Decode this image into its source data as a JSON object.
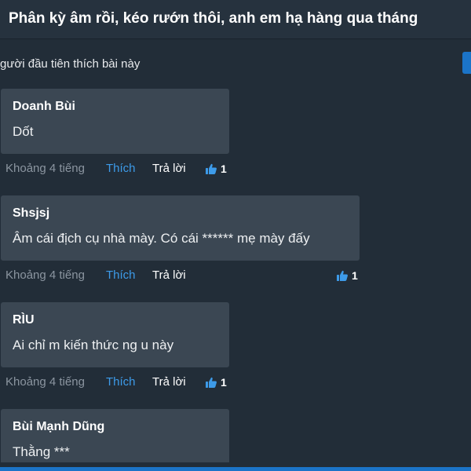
{
  "header": {
    "title": "Phân kỳ âm rồi, kéo rướn thôi, anh em hạ hàng qua tháng"
  },
  "likes_summary": {
    "text": "gười đầu tiên thích bài này"
  },
  "colors": {
    "background": "#222d38",
    "bubble": "#3b4753",
    "accent_blue": "#3d9be9",
    "muted_text": "#8b95a0"
  },
  "comments": [
    {
      "author": "Doanh Bùi",
      "text": "Dốt",
      "time": "Khoảng 4 tiếng",
      "like_label": "Thích",
      "reply_label": "Trả lời",
      "like_icon": "thumbs-up-icon",
      "like_count": "1"
    },
    {
      "author": "Shsjsj",
      "text": "Âm cái địch cụ nhà mày. Có cái ****** mẹ mày đấy",
      "time": "Khoảng 4 tiếng",
      "like_label": "Thích",
      "reply_label": "Trả lời",
      "like_icon": "thumbs-up-icon",
      "like_count": "1"
    },
    {
      "author": "RÌU",
      "text": "Ai chỉ m kiến thức ng u này",
      "time": "Khoảng 4 tiếng",
      "like_label": "Thích",
      "reply_label": "Trả lời",
      "like_icon": "thumbs-up-icon",
      "like_count": "1"
    },
    {
      "author": "Bùi Mạnh Dũng",
      "text": "Thằng ***"
    }
  ]
}
